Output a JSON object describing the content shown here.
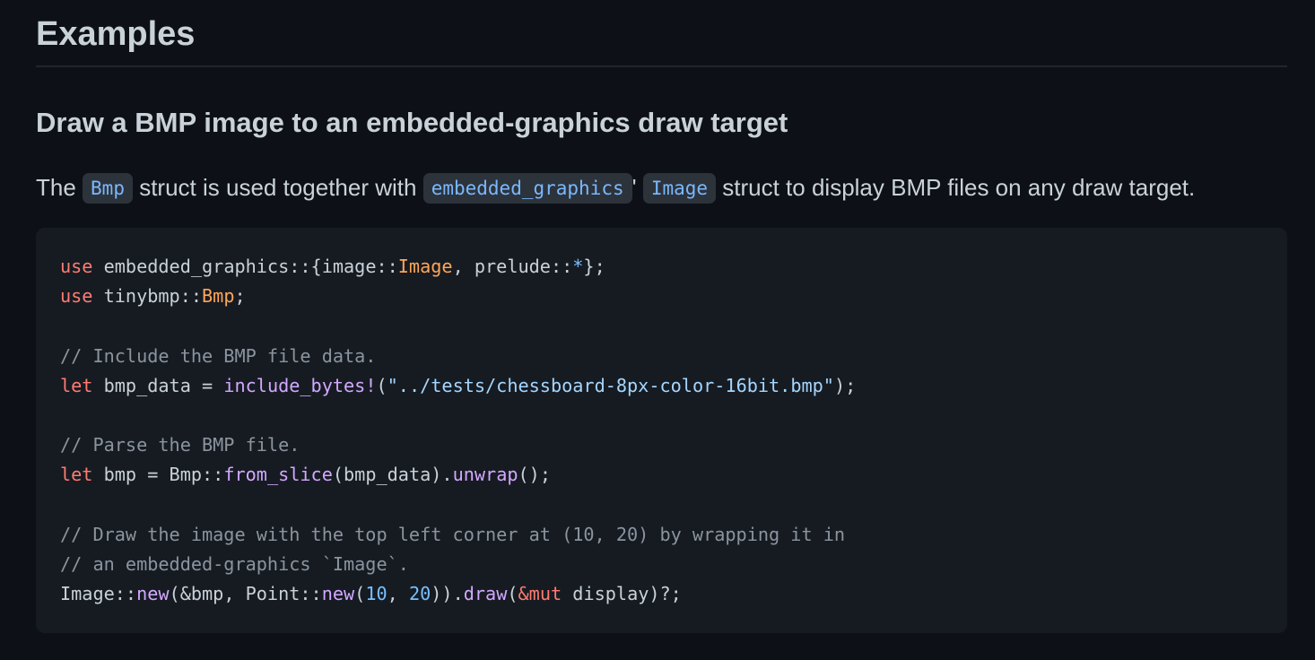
{
  "heading": "Examples",
  "subheading": "Draw a BMP image to an embedded-graphics draw target",
  "paragraph": [
    {
      "kind": "text",
      "value": "The "
    },
    {
      "kind": "code",
      "value": "Bmp"
    },
    {
      "kind": "text",
      "value": " struct is used together with "
    },
    {
      "kind": "code",
      "value": "embedded_graphics"
    },
    {
      "kind": "text",
      "value": "' "
    },
    {
      "kind": "code",
      "value": "Image"
    },
    {
      "kind": "text",
      "value": " struct to display BMP files on any draw target."
    }
  ],
  "code": {
    "lines": [
      [
        [
          "kw",
          "use"
        ],
        [
          "pl",
          " embedded_graphics::{image::"
        ],
        [
          "ty",
          "Image"
        ],
        [
          "pl",
          ", prelude::"
        ],
        [
          "op",
          "*"
        ],
        [
          "pl",
          "};"
        ]
      ],
      [
        [
          "kw",
          "use"
        ],
        [
          "pl",
          " tinybmp::"
        ],
        [
          "ty",
          "Bmp"
        ],
        [
          "pl",
          ";"
        ]
      ],
      [],
      [
        [
          "cm",
          "// Include the BMP file data."
        ]
      ],
      [
        [
          "kw",
          "let"
        ],
        [
          "pl",
          " bmp_data = "
        ],
        [
          "fn",
          "include_bytes!"
        ],
        [
          "pl",
          "("
        ],
        [
          "st",
          "\"../tests/chessboard-8px-color-16bit.bmp\""
        ],
        [
          "pl",
          ");"
        ]
      ],
      [],
      [
        [
          "cm",
          "// Parse the BMP file."
        ]
      ],
      [
        [
          "kw",
          "let"
        ],
        [
          "pl",
          " bmp = Bmp::"
        ],
        [
          "fn",
          "from_slice"
        ],
        [
          "pl",
          "(bmp_data)."
        ],
        [
          "fn",
          "unwrap"
        ],
        [
          "pl",
          "();"
        ]
      ],
      [],
      [
        [
          "cm",
          "// Draw the image with the top left corner at (10, 20) by wrapping it in"
        ]
      ],
      [
        [
          "cm",
          "// an embedded-graphics `Image`."
        ]
      ],
      [
        [
          "pl",
          "Image::"
        ],
        [
          "fn",
          "new"
        ],
        [
          "pl",
          "(&bmp, Point::"
        ],
        [
          "fn",
          "new"
        ],
        [
          "pl",
          "("
        ],
        [
          "nm",
          "10"
        ],
        [
          "pl",
          ", "
        ],
        [
          "nm",
          "20"
        ],
        [
          "pl",
          "))."
        ],
        [
          "fn",
          "draw"
        ],
        [
          "pl",
          "("
        ],
        [
          "kw",
          "&mut"
        ],
        [
          "pl",
          " display)?;"
        ]
      ]
    ]
  },
  "colors": {
    "background": "#0d1117",
    "code_background": "#161b22",
    "keyword": "#ff7b72",
    "type": "#ffa657",
    "function": "#d2a8ff",
    "comment": "#8b949e",
    "string": "#a5d6ff",
    "number": "#79c0ff"
  }
}
